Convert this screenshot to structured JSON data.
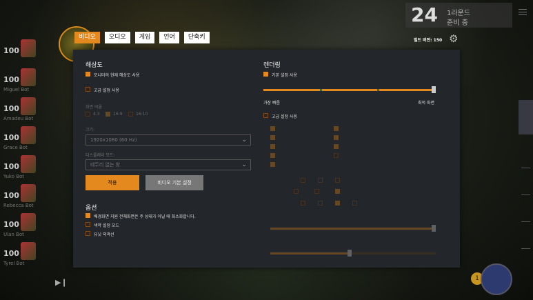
{
  "tabs": [
    "비디오",
    "오디오",
    "게임",
    "언어",
    "단축키"
  ],
  "build": "빌드 버전: 150",
  "round": {
    "number": "24",
    "line1": "1라운드",
    "line2": "준비 중"
  },
  "players": [
    {
      "level": "",
      "hp": "100",
      "name": ""
    },
    {
      "level": "",
      "hp": "100",
      "name": "Miguel Bot"
    },
    {
      "level": "",
      "hp": "100",
      "name": "Amadeu Bot"
    },
    {
      "level": "",
      "hp": "100",
      "name": "Grace Bot"
    },
    {
      "level": "",
      "hp": "100",
      "name": "Yuko Bot"
    },
    {
      "level": "",
      "hp": "100",
      "name": "Rebecca Bot"
    },
    {
      "level": "",
      "hp": "100",
      "name": "Ulan Bot"
    },
    {
      "level": "",
      "hp": "100",
      "name": "Tyrel Bot"
    }
  ],
  "resolution": {
    "heading": "해상도",
    "monitor_res": "모니터의 현재 해상도 사용",
    "advanced": "고급 설정 사용",
    "aspect_label": "화면 비율",
    "aspect_opts": [
      "4:3",
      "16:9",
      "16:10"
    ],
    "size_label": "크기:",
    "size_value": "1920x1080 (60 Hz)",
    "display_label": "디스플레이 모드:",
    "display_value": "테두리 없는 창",
    "apply": "적용",
    "defaults": "비디오 기본 설정"
  },
  "options": {
    "heading": "옵션",
    "opt1": "배경화면 지원 전체화면은 주 상태가 아닐 때 최소화합니다.",
    "opt2": "색약 설정 모드",
    "opt3": "유닛 외곽선"
  },
  "render": {
    "heading": "렌더링",
    "basic": "기본 설정 사용",
    "fast": "가장 빠름",
    "best": "최적 화면",
    "advanced": "고급 설정 사용",
    "quality_value": 1.0
  },
  "colors": {
    "accent": "#e4891e",
    "panel": "#23262a"
  }
}
